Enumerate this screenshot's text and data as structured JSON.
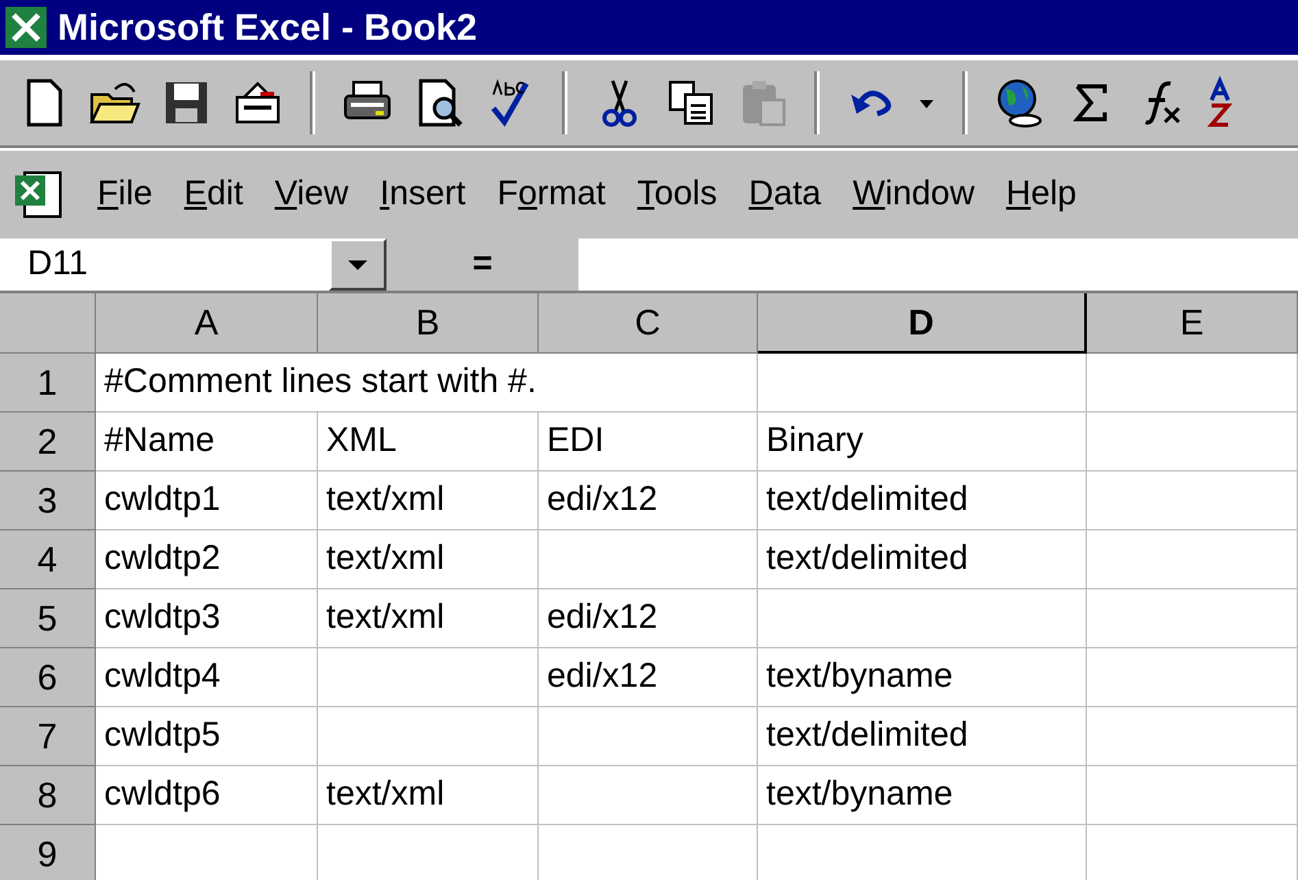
{
  "window": {
    "title": "Microsoft Excel - Book2"
  },
  "toolbar": [
    {
      "kind": "new",
      "disabled": false
    },
    {
      "kind": "open",
      "disabled": false
    },
    {
      "kind": "save",
      "disabled": false
    },
    {
      "kind": "mail",
      "disabled": false
    },
    {
      "kind": "sep"
    },
    {
      "kind": "print",
      "disabled": false
    },
    {
      "kind": "preview",
      "disabled": false
    },
    {
      "kind": "spell",
      "disabled": false
    },
    {
      "kind": "sep"
    },
    {
      "kind": "cut",
      "disabled": false
    },
    {
      "kind": "copy",
      "disabled": false
    },
    {
      "kind": "paste",
      "disabled": true
    },
    {
      "kind": "sep"
    },
    {
      "kind": "undo",
      "disabled": false
    },
    {
      "kind": "dropdown",
      "disabled": false
    },
    {
      "kind": "sep"
    },
    {
      "kind": "web",
      "disabled": false
    },
    {
      "kind": "sum",
      "disabled": false
    },
    {
      "kind": "function",
      "disabled": false
    },
    {
      "kind": "sort",
      "disabled": false
    }
  ],
  "menu": [
    {
      "mnemonic": "F",
      "rest": "ile"
    },
    {
      "mnemonic": "E",
      "rest": "dit"
    },
    {
      "mnemonic": "V",
      "rest": "iew"
    },
    {
      "mnemonic": "I",
      "rest": "nsert"
    },
    {
      "lead": "F",
      "mnemonic": "o",
      "rest": "rmat"
    },
    {
      "mnemonic": "T",
      "rest": "ools"
    },
    {
      "mnemonic": "D",
      "rest": "ata"
    },
    {
      "mnemonic": "W",
      "rest": "indow"
    },
    {
      "mnemonic": "H",
      "rest": "elp"
    }
  ],
  "formula_bar": {
    "name_box": "D11",
    "equals": "="
  },
  "columns": [
    {
      "label": "A",
      "selected": false
    },
    {
      "label": "B",
      "selected": false
    },
    {
      "label": "C",
      "selected": false
    },
    {
      "label": "D",
      "selected": true
    },
    {
      "label": "E",
      "selected": false
    }
  ],
  "rows": [
    {
      "number": "1",
      "span": "#Comment lines start with #.",
      "cells": [
        "",
        "",
        "",
        "",
        ""
      ]
    },
    {
      "number": "2",
      "cells": [
        "#Name",
        "XML",
        "EDI",
        "Binary",
        ""
      ]
    },
    {
      "number": "3",
      "cells": [
        "cwldtp1",
        "text/xml",
        "edi/x12",
        "text/delimited",
        ""
      ]
    },
    {
      "number": "4",
      "cells": [
        "cwldtp2",
        "text/xml",
        "",
        "text/delimited",
        ""
      ]
    },
    {
      "number": "5",
      "cells": [
        "cwldtp3",
        "text/xml",
        "edi/x12",
        "",
        ""
      ]
    },
    {
      "number": "6",
      "cells": [
        "cwldtp4",
        "",
        "edi/x12",
        "text/byname",
        ""
      ]
    },
    {
      "number": "7",
      "cells": [
        "cwldtp5",
        "",
        "",
        "text/delimited",
        ""
      ]
    },
    {
      "number": "8",
      "cells": [
        "cwldtp6",
        "text/xml",
        "",
        "text/byname",
        ""
      ]
    },
    {
      "number": "9",
      "cells": [
        "",
        "",
        "",
        "",
        ""
      ]
    }
  ]
}
